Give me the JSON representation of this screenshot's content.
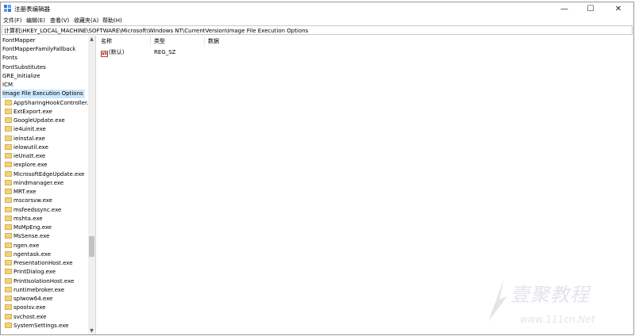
{
  "window": {
    "title": "注册表编辑器",
    "controls": {
      "minimize": "—",
      "maximize": "☐",
      "close": "✕"
    }
  },
  "menu": [
    "文件(F)",
    "编辑(E)",
    "查看(V)",
    "收藏夹(A)",
    "帮助(H)"
  ],
  "address": "计算机\\HKEY_LOCAL_MACHINE\\SOFTWARE\\Microsoft\\Windows NT\\CurrentVersion\\Image File Execution Options",
  "tree": {
    "top_keys": [
      "FontMapper",
      "FontMapperFamilyFallback",
      "Fonts",
      "FontSubstitutes",
      "GRE_Initialize",
      "ICM",
      "Image File Execution Options"
    ],
    "selected": "Image File Execution Options",
    "child_keys": [
      "AppSharingHookController.exe",
      "ExtExport.exe",
      "GoogleUpdate.exe",
      "ie4uinit.exe",
      "ieinstal.exe",
      "ielowutil.exe",
      "ieUnatt.exe",
      "iexplore.exe",
      "MicrosoftEdgeUpdate.exe",
      "mindmanager.exe",
      "MRT.exe",
      "mscorsvw.exe",
      "msfeedssync.exe",
      "mshta.exe",
      "MsMpEng.exe",
      "MsSense.exe",
      "ngen.exe",
      "ngentask.exe",
      "PresentationHost.exe",
      "PrintDialog.exe",
      "PrintIsolationHost.exe",
      "runtimebroker.exe",
      "splwow64.exe",
      "spoolsv.exe",
      "svchost.exe",
      "SystemSettings.exe"
    ]
  },
  "columns": {
    "name": "名称",
    "type": "类型",
    "data": "数据"
  },
  "values": [
    {
      "name": "(默认)",
      "type": "REG_SZ",
      "data": "",
      "icon": "ab-icon"
    }
  ],
  "watermark": {
    "text": "壹聚教程",
    "url": "www.111cn.Net"
  },
  "colors": {
    "selection": "#cce8ff",
    "folder": "#f3d27a"
  }
}
